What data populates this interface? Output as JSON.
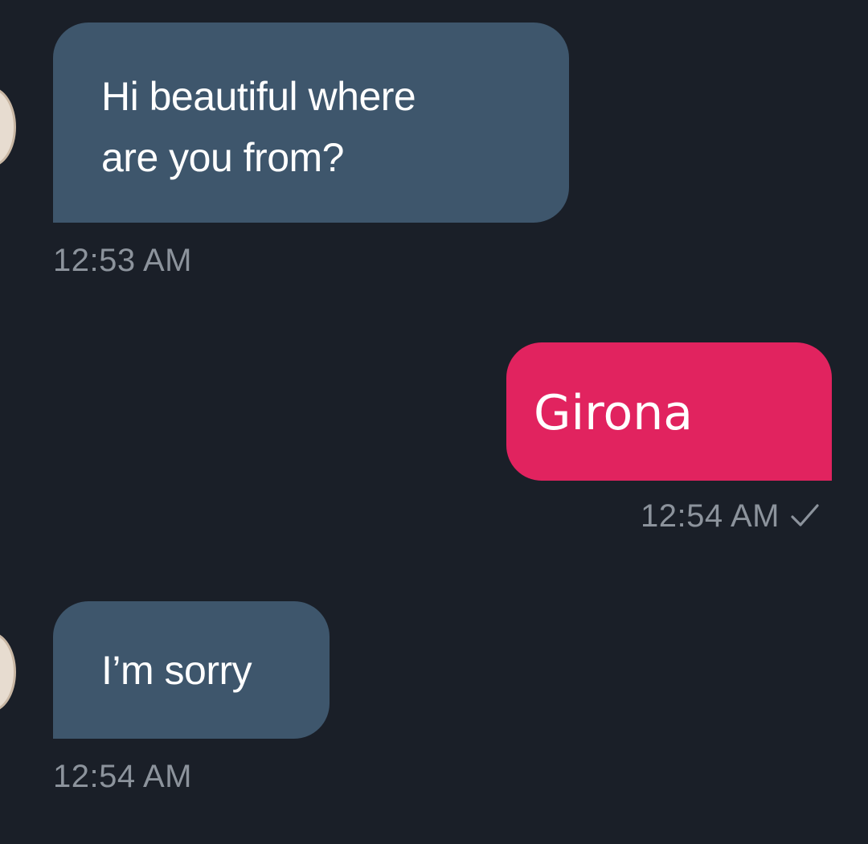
{
  "conversation": {
    "messages": [
      {
        "direction": "incoming",
        "text": "Hi beautiful where\nare you from?",
        "time": "12:53 AM"
      },
      {
        "direction": "outgoing",
        "text": "Girona",
        "time": "12:54 AM",
        "status_icon": "check-icon"
      },
      {
        "direction": "incoming",
        "text": "I’m sorry",
        "time": "12:54 AM"
      }
    ]
  },
  "colors": {
    "background": "#1a1f28",
    "incoming_bubble": "#3e566c",
    "outgoing_bubble": "#e1235f",
    "timestamp": "#8c939c"
  }
}
